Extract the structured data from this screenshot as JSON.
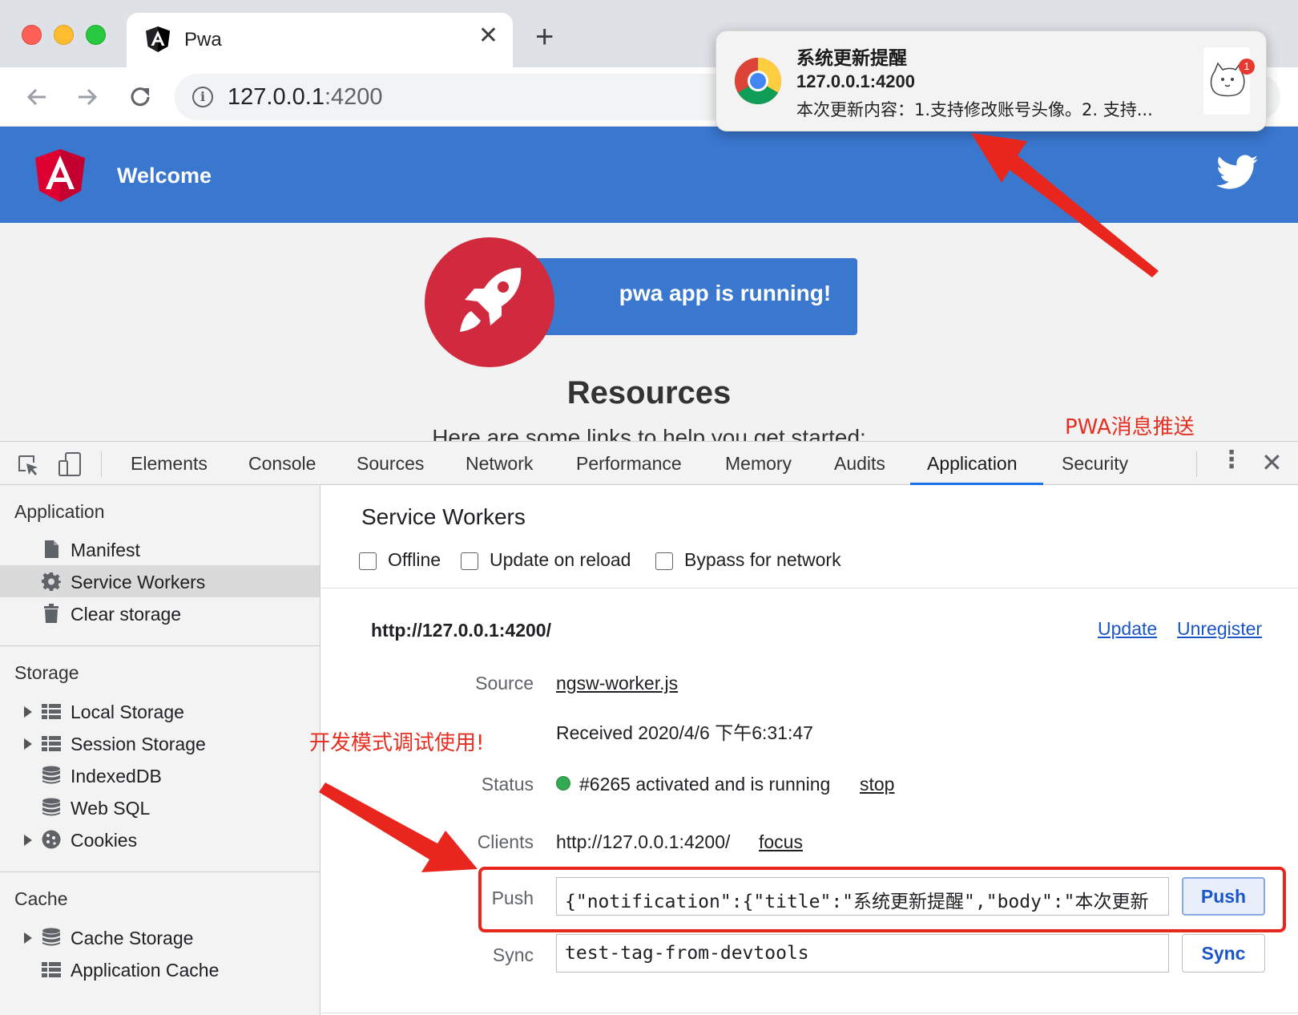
{
  "browser": {
    "tab_title": "Pwa",
    "tab_close": "✕",
    "new_tab": "+",
    "url_host": "127.0.0.1",
    "url_port": ":4200"
  },
  "page": {
    "header_title": "Welcome",
    "running_text": "pwa app is running!",
    "resources_title": "Resources",
    "resources_subtitle": "Here are some links to help you get started:"
  },
  "notification": {
    "title": "系统更新提醒",
    "origin": "127.0.0.1:4200",
    "body": "本次更新内容：1.支持修改账号头像。2. 支持...",
    "badge": "1"
  },
  "annotations": {
    "pwa_push": "PWA消息推送",
    "dev_mode": "开发模式调试使用!"
  },
  "devtools": {
    "tabs": [
      "Elements",
      "Console",
      "Sources",
      "Network",
      "Performance",
      "Memory",
      "Audits",
      "Application",
      "Security"
    ],
    "active_tab": "Application",
    "sidebar": {
      "application_heading": "Application",
      "application_items": [
        "Manifest",
        "Service Workers",
        "Clear storage"
      ],
      "selected_item": "Service Workers",
      "storage_heading": "Storage",
      "storage_items": [
        "Local Storage",
        "Session Storage",
        "IndexedDB",
        "Web SQL",
        "Cookies"
      ],
      "cache_heading": "Cache",
      "cache_items": [
        "Cache Storage",
        "Application Cache"
      ]
    },
    "service_workers": {
      "title": "Service Workers",
      "options": [
        "Offline",
        "Update on reload",
        "Bypass for network"
      ],
      "origin": "http://127.0.0.1:4200/",
      "update_link": "Update",
      "unregister_link": "Unregister",
      "source_label": "Source",
      "source_link": "ngsw-worker.js",
      "received": "Received 2020/4/6 下午6:31:47",
      "status_label": "Status",
      "status_text": "#6265 activated and is running",
      "status_color": "#34a853",
      "stop_link": "stop",
      "clients_label": "Clients",
      "clients_value": "http://127.0.0.1:4200/",
      "focus_link": "focus",
      "push_label": "Push",
      "push_value": "{\"notification\":{\"title\":\"系统更新提醒\",\"body\":\"本次更新",
      "push_button": "Push",
      "sync_label": "Sync",
      "sync_value": "test-tag-from-devtools",
      "sync_button": "Sync"
    }
  },
  "colors": {
    "header_blue": "#3a77cf",
    "angular_red": "#d1293d",
    "annotation_red": "#e52f22",
    "link_blue": "#1a56c6"
  }
}
